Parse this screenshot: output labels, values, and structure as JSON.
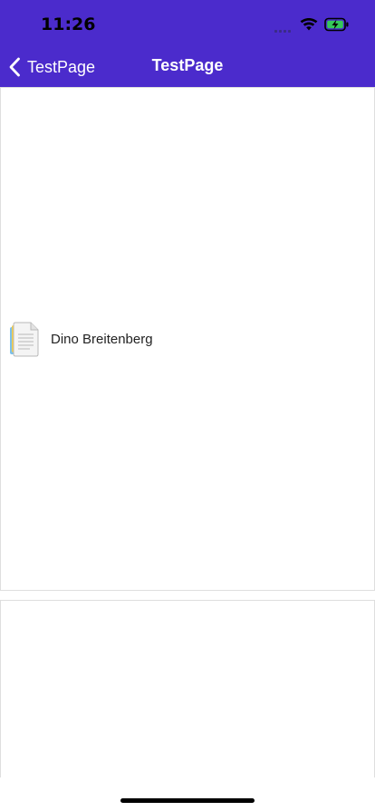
{
  "status_bar": {
    "time": "11:26"
  },
  "nav": {
    "back_label": "TestPage",
    "title": "TestPage"
  },
  "list": {
    "items": [
      {
        "label": "Dino Breitenberg",
        "icon": "document-icon"
      }
    ]
  },
  "colors": {
    "header": "#4b2bcc",
    "battery_fill": "#35c759",
    "card_border": "#dedede"
  }
}
